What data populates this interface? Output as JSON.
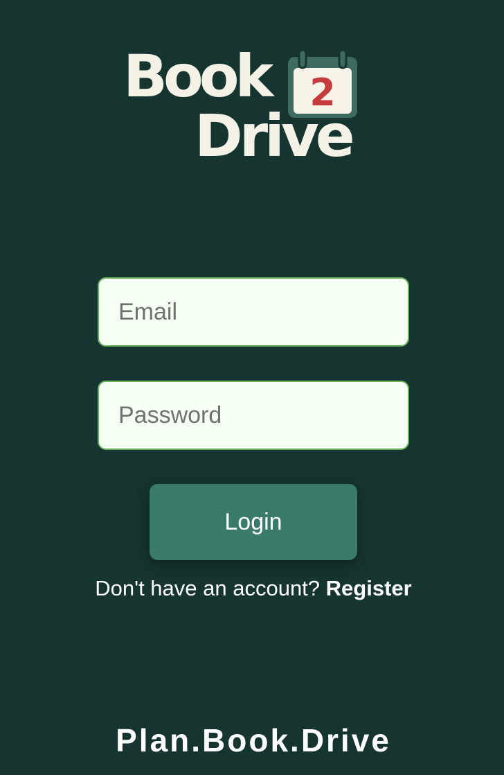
{
  "logo": {
    "word_top": "Book",
    "word_bottom": "Drive",
    "calendar_number": "2",
    "colors": {
      "text": "#f4f1e6",
      "calendar_frame": "#3d6b60",
      "calendar_page": "#f7f3e8",
      "number": "#c63b3b"
    }
  },
  "login_form": {
    "email_placeholder": "Email",
    "password_placeholder": "Password",
    "login_label": "Login"
  },
  "register": {
    "prompt": "Don't have an account?",
    "link_label": "Register"
  },
  "tagline": "Plan.Book.Drive",
  "colors": {
    "background": "#163530",
    "button": "#3a7a6a",
    "field_border": "#6ab160",
    "field_fill": "#f6fff4"
  }
}
